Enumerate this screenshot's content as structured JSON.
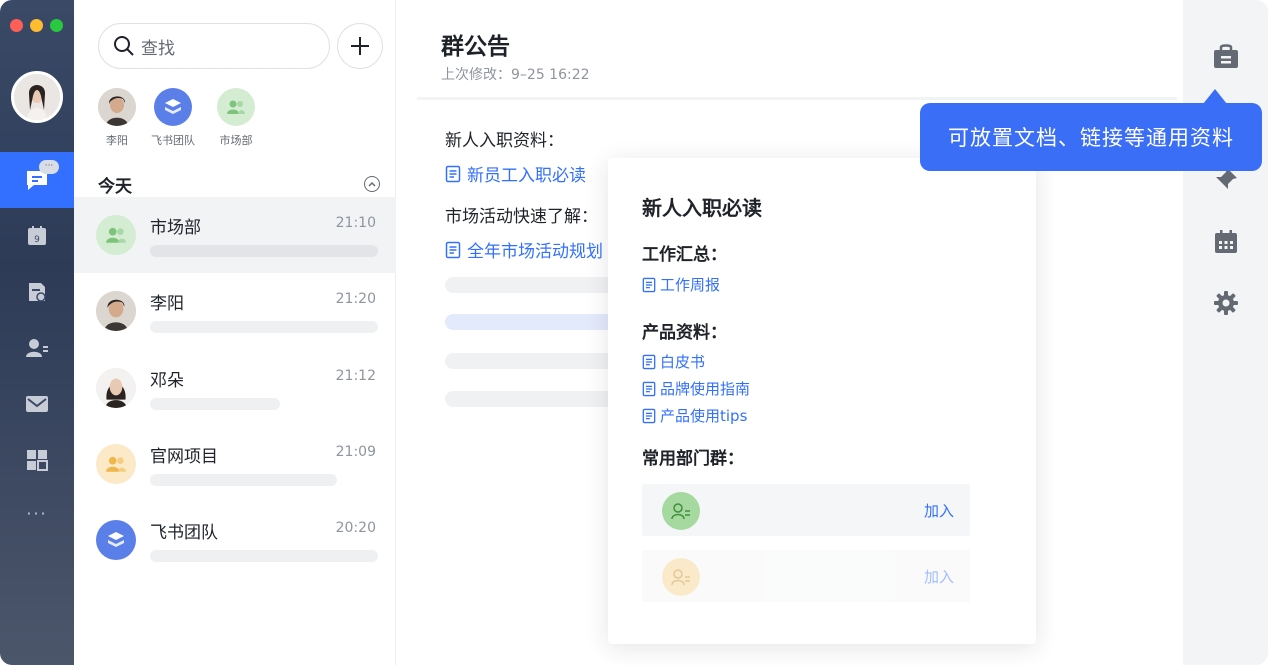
{
  "colors": {
    "accent": "#3370ff",
    "tooltip": "#3a6ef6",
    "rail_bg": "#2d3b57",
    "traffic_red": "#ff5f57",
    "traffic_yellow": "#febc2e",
    "traffic_green": "#28c840"
  },
  "rail": {
    "icons": [
      "chat-icon",
      "calendar-icon",
      "docs-icon",
      "contacts-icon",
      "mail-icon",
      "apps-icon"
    ],
    "badge": "···",
    "more": "···"
  },
  "chatlist": {
    "search_placeholder": "查找",
    "pinned": [
      {
        "name": "李阳",
        "icon": "person-avatar"
      },
      {
        "name": "飞书团队",
        "icon": "cube-icon"
      },
      {
        "name": "市场部",
        "icon": "group-icon"
      }
    ],
    "section_title": "今天",
    "chats": [
      {
        "title": "市场部",
        "time": "21:10"
      },
      {
        "title": "李阳",
        "time": "21:20"
      },
      {
        "title": "邓朵",
        "time": "21:12"
      },
      {
        "title": "官网项目",
        "time": "21:09"
      },
      {
        "title": "飞书团队",
        "time": "20:20"
      }
    ]
  },
  "announcement": {
    "title": "群公告",
    "modified": "上次修改：9–25 16:22",
    "sections": [
      {
        "heading": "新人入职资料：",
        "doc": "新员工入职必读"
      },
      {
        "heading": "市场活动快速了解：",
        "doc": "全年市场活动规划"
      }
    ]
  },
  "card": {
    "title": "新人入职必读",
    "work_heading": "工作汇总：",
    "work_links": [
      "工作周报"
    ],
    "product_heading": "产品资料：",
    "product_links": [
      "白皮书",
      "品牌使用指南",
      "产品使用tips"
    ],
    "groups_heading": "常用部门群：",
    "groups": [
      {
        "join": "加入"
      },
      {
        "join": "加入"
      }
    ]
  },
  "toolbar": {
    "icons": [
      "announcement-icon",
      "pin-icon",
      "calendar-icon",
      "settings-icon"
    ]
  },
  "tooltip": {
    "text": "可放置文档、链接等通用资料"
  }
}
